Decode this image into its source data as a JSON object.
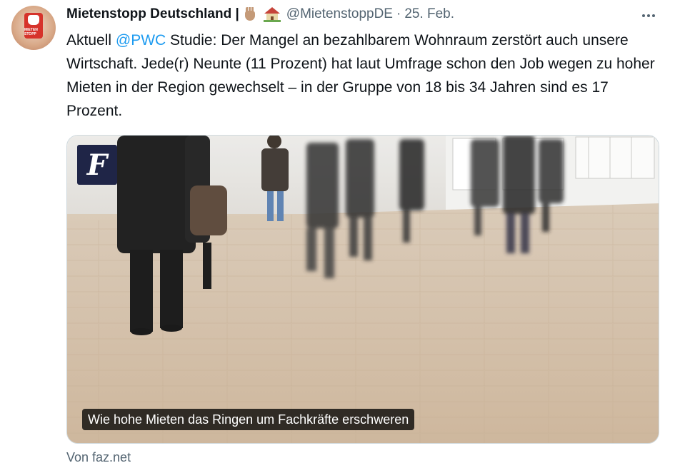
{
  "tweet": {
    "display_name": "Mietenstopp Deutschland |",
    "handle": "@MietenstoppDE",
    "separator": "·",
    "date": "25. Feb.",
    "emojis": [
      "raised-hand",
      "house-with-garden"
    ],
    "avatar_text": "MIETEN STOPP",
    "text_before": "Aktuell ",
    "mention": "@PWC",
    "text_after": " Studie: Der Mangel an bezahlbarem Wohnraum zerstört auch unsere Wirtschaft. Jede(r) Neunte (11 Prozent) hat laut Umfrage schon den Job wegen zu hoher Mieten in der Region gewechselt – in der Gruppe von 18 bis 34 Jahren sind es 17 Prozent."
  },
  "card": {
    "caption": "Wie hohe Mieten das Ringen um Fachkräfte erschweren",
    "logo_letter": "F",
    "source": "Von faz.net"
  },
  "colors": {
    "text": "#0f1419",
    "muted": "#536471",
    "link": "#1d9bf0",
    "border": "#cfd9de",
    "faz_blue": "#1f2547"
  }
}
